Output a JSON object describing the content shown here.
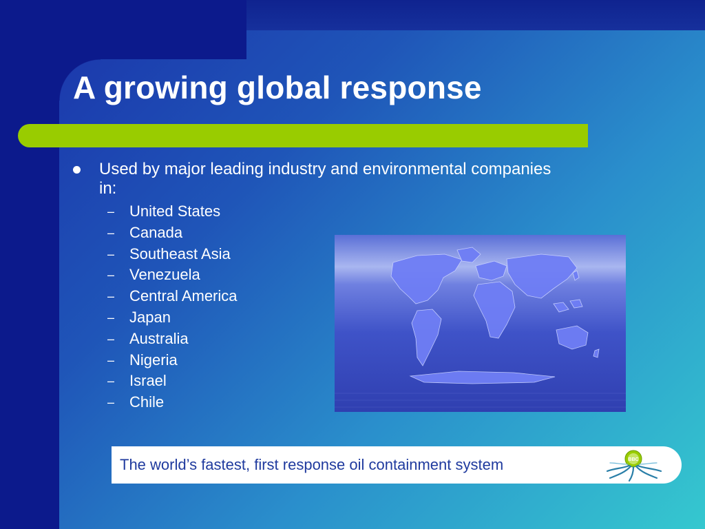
{
  "slide": {
    "title": "A growing global response",
    "bullet": "Used by major leading industry and environmental companies in:",
    "dash": "–",
    "countries": [
      "United States",
      "Canada",
      "Southeast Asia",
      "Venezuela",
      "Central America",
      "Japan",
      "Australia",
      "Nigeria",
      "Israel",
      "Chile"
    ],
    "banner": "The world’s fastest, first response oil containment system",
    "logo_text": "BBC"
  },
  "colors": {
    "accent_green": "#99cc00",
    "navy": "#0c1a8c",
    "banner_text": "#1f3a9e",
    "map_land": "#6f7ef5"
  },
  "icons": {
    "logo": "octopus-logo-icon",
    "map": "world-map-image"
  }
}
